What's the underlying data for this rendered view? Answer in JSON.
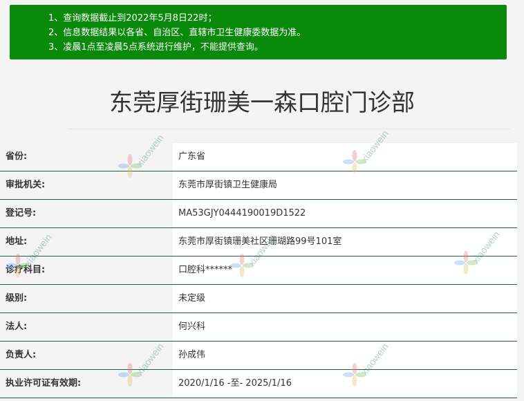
{
  "notice": {
    "lines": [
      "1、查询数据截止到2022年5月8日22时；",
      "2、信息数据结果以各省、自治区、直辖市卫生健康委数据为准。",
      "3、凌晨1点至凌晨5点系统进行维护，不能提供查询。"
    ]
  },
  "title": "东莞厚街珊美一森口腔门诊部",
  "rows": [
    {
      "key": "省份:",
      "value": "广东省"
    },
    {
      "key": "审批机关:",
      "value": "东莞市厚街镇卫生健康局"
    },
    {
      "key": "登记号:",
      "value": "MA53GJY0444190019D1522"
    },
    {
      "key": "地址:",
      "value": "东莞市厚街镇珊美社区珊瑚路99号101室"
    },
    {
      "key": "诊疗科目:",
      "value": "口腔科******"
    },
    {
      "key": "级别:",
      "value": "未定级"
    },
    {
      "key": "法人:",
      "value": "何兴科"
    },
    {
      "key": "负责人:",
      "value": "孙成伟"
    },
    {
      "key": "执业许可证有效期:",
      "value": "2020/1/16 -至- 2025/1/16"
    }
  ],
  "watermark": {
    "text": "xiaowein",
    "color": "#2f7f5f"
  }
}
